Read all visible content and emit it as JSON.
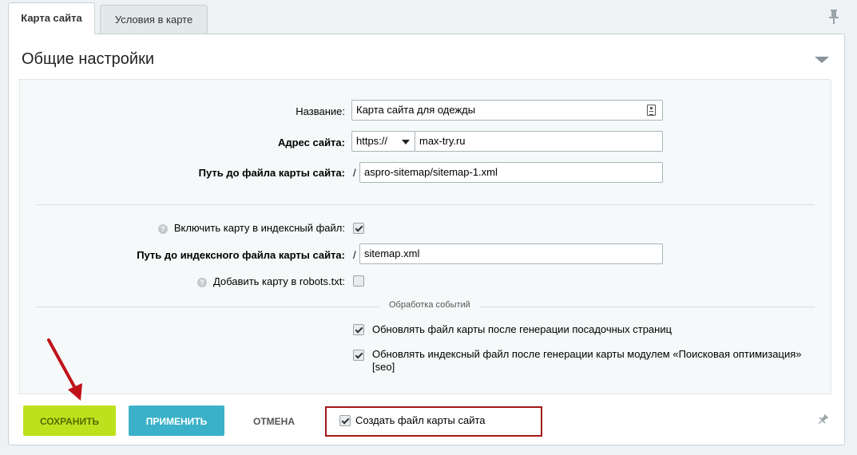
{
  "tabs": [
    {
      "label": "Карта сайта",
      "active": true
    },
    {
      "label": "Условия в карте",
      "active": false
    }
  ],
  "section": {
    "title": "Общие настройки"
  },
  "form": {
    "name_label": "Название:",
    "name_value": "Карта сайта для одежды",
    "address_label": "Адрес сайта:",
    "protocol_value": "https://",
    "domain_value": "max-try.ru",
    "path_label": "Путь до файла карты сайта:",
    "path_slash": "/",
    "path_value": "aspro-sitemap/sitemap-1.xml",
    "include_index_label": "Включить карту в индексный файл:",
    "include_index_checked": true,
    "index_path_label": "Путь до индексного файла карты сайта:",
    "index_path_slash": "/",
    "index_path_value": "sitemap.xml",
    "robots_label": "Добавить карту в robots.txt:",
    "robots_checked": false,
    "events_header": "Обработка событий",
    "update_after_landing_label": "Обновлять файл карты после генерации посадочных страниц",
    "update_after_landing_checked": true,
    "update_index_label_line1": "Обновлять индексный файл после генерации карты модулем «Поисковая оптимизация»",
    "update_index_label_line2": "[seo]",
    "update_index_checked": true
  },
  "footer": {
    "save_label": "Сохранить",
    "apply_label": "Применить",
    "cancel_label": "Отмена",
    "create_file_label": "Создать файл карты сайта",
    "create_file_checked": true
  },
  "colors": {
    "save_button": "#bde21d",
    "apply_button": "#3bb1c9",
    "highlight_border": "#a31616",
    "annotation_arrow": "#c0121a"
  }
}
